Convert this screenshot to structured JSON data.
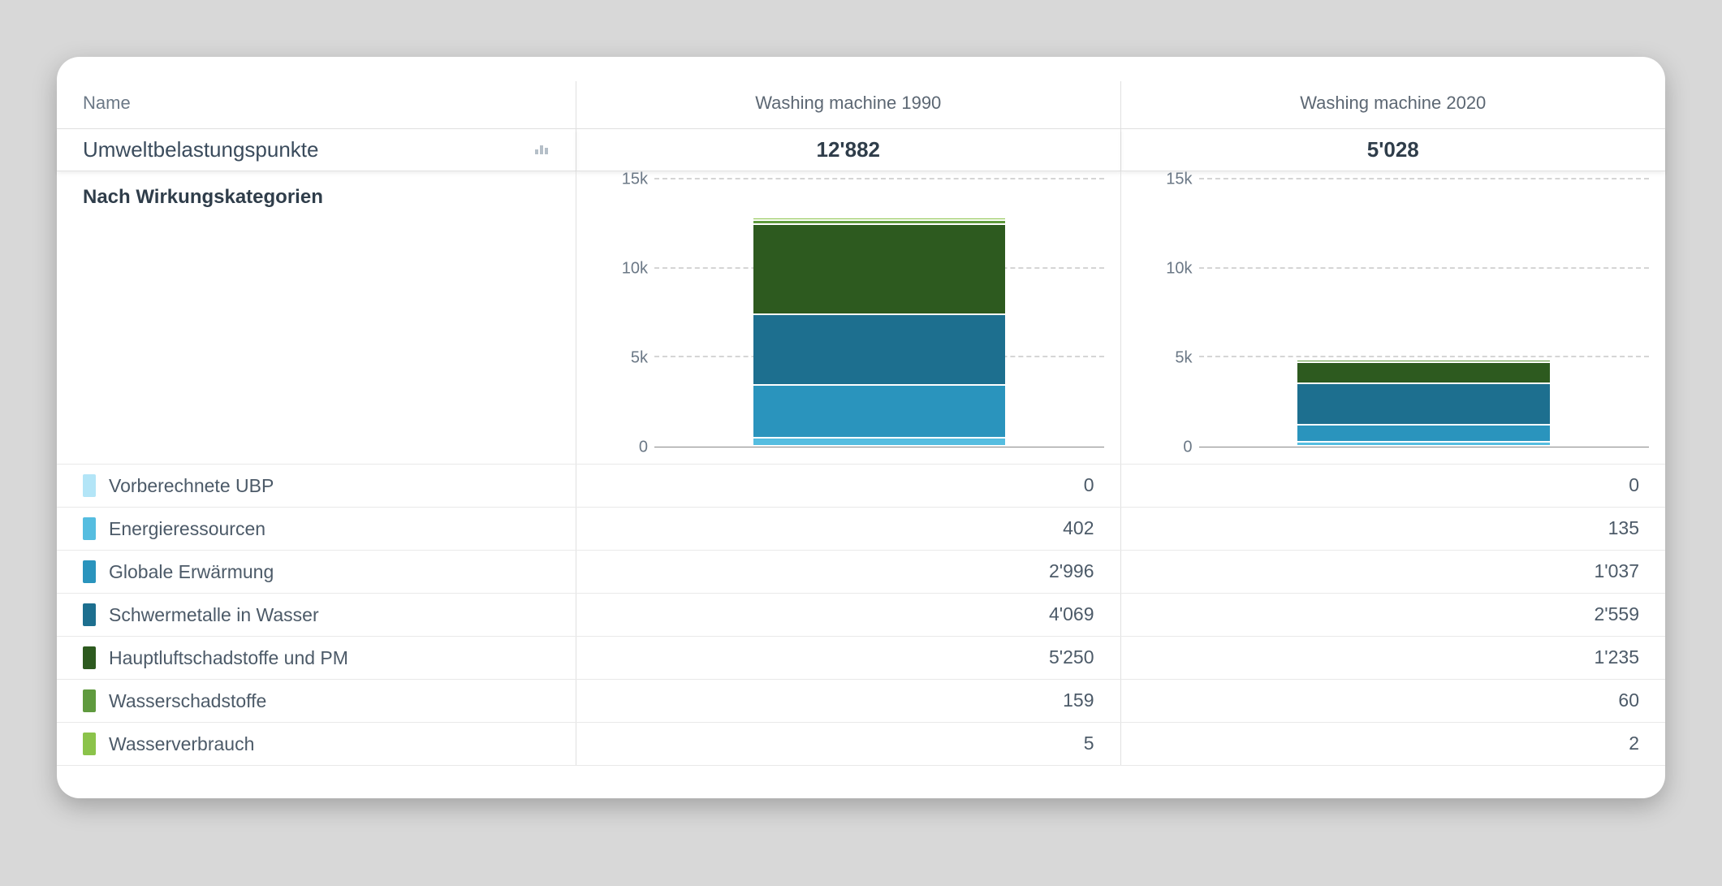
{
  "header": {
    "name_col": "Name",
    "cols": [
      "Washing machine 1990",
      "Washing machine 2020"
    ]
  },
  "metric": {
    "label": "Umweltbelastungspunkte",
    "values": [
      "12'882",
      "5'028"
    ]
  },
  "section_label": "Nach Wirkungskategorien",
  "categories": [
    {
      "label": "Vorberechnete UBP",
      "color": "#b3e5f7",
      "v": [
        "0",
        "0"
      ]
    },
    {
      "label": "Energieressourcen",
      "color": "#55bde0",
      "v": [
        "402",
        "135"
      ]
    },
    {
      "label": "Globale Erwärmung",
      "color": "#2a94bd",
      "v": [
        "2'996",
        "1'037"
      ]
    },
    {
      "label": "Schwermetalle in Wasser",
      "color": "#1d6f8f",
      "v": [
        "4'069",
        "2'559"
      ]
    },
    {
      "label": "Hauptluftschadstoffe und PM",
      "color": "#2d5a1f",
      "v": [
        "5'250",
        "1'235"
      ]
    },
    {
      "label": "Wasserschadstoffe",
      "color": "#5f9a3e",
      "v": [
        "159",
        "60"
      ]
    },
    {
      "label": "Wasserverbrauch",
      "color": "#8bc34a",
      "v": [
        "5",
        "2"
      ]
    }
  ],
  "chart_data": {
    "type": "bar",
    "title": "Nach Wirkungskategorien",
    "ylabel": "",
    "ylim": [
      0,
      15000
    ],
    "yticks": [
      0,
      5000,
      10000,
      15000
    ],
    "ytick_labels": [
      "0",
      "5k",
      "10k",
      "15k"
    ],
    "categories": [
      "Washing machine 1990",
      "Washing machine 2020"
    ],
    "series": [
      {
        "name": "Vorberechnete UBP",
        "color": "#b3e5f7",
        "values": [
          0,
          0
        ]
      },
      {
        "name": "Energieressourcen",
        "color": "#55bde0",
        "values": [
          402,
          135
        ]
      },
      {
        "name": "Globale Erwärmung",
        "color": "#2a94bd",
        "values": [
          2996,
          1037
        ]
      },
      {
        "name": "Schwermetalle in Wasser",
        "color": "#1d6f8f",
        "values": [
          4069,
          2559
        ]
      },
      {
        "name": "Hauptluftschadstoffe und PM",
        "color": "#2d5a1f",
        "values": [
          5250,
          1235
        ]
      },
      {
        "name": "Wasserschadstoffe",
        "color": "#5f9a3e",
        "values": [
          159,
          60
        ]
      },
      {
        "name": "Wasserverbrauch",
        "color": "#8bc34a",
        "values": [
          5,
          2
        ]
      }
    ]
  }
}
